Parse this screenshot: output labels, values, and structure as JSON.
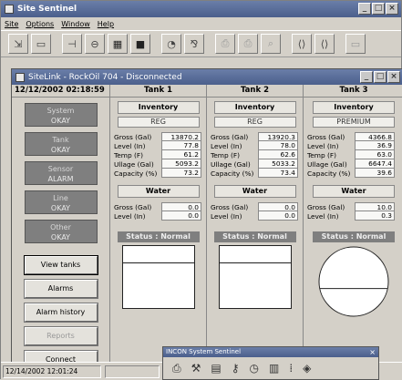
{
  "app": {
    "title": "Site Sentinel",
    "menu": [
      "Site",
      "Options",
      "Window",
      "Help"
    ]
  },
  "toolbar": {
    "icons": [
      "open-icon",
      "save-icon",
      "tank-probe-icon",
      "gauge-icon",
      "monitor-icon",
      "display-icon",
      "alarm-bell-icon",
      "sensor-icon",
      "print-icon",
      "print-preview-icon",
      "report-icon",
      "prev-icon",
      "next-icon",
      "window-icon"
    ]
  },
  "child": {
    "title": "SiteLink - RockOil 704 - Disconnected",
    "datetime": "12/12/2002 02:18:59",
    "status_boxes": [
      {
        "label": "System",
        "state": "OKAY"
      },
      {
        "label": "Tank",
        "state": "OKAY"
      },
      {
        "label": "Sensor",
        "state": "ALARM"
      },
      {
        "label": "Line",
        "state": "OKAY"
      },
      {
        "label": "Other",
        "state": "OKAY"
      }
    ],
    "buttons": {
      "view_tanks": "View tanks",
      "alarms": "Alarms",
      "alarm_history": "Alarm history",
      "reports": "Reports",
      "connect": "Connect"
    }
  },
  "labels": {
    "inventory": "Inventory",
    "water": "Water",
    "gross": "Gross (Gal)",
    "level": "Level (In)",
    "temp": "Temp (F)",
    "ullage": "Ullage (Gal)",
    "capacity": "Capacity (%)"
  },
  "tanks": [
    {
      "name": "Tank 1",
      "product": "REG",
      "gross": "13870.2",
      "level": "77.8",
      "temp": "61.2",
      "ullage": "5093.2",
      "capacity": "73.2",
      "water_gross": "0.0",
      "water_level": "0.0",
      "status": "Status : Normal",
      "fill_fraction": 0.73
    },
    {
      "name": "Tank 2",
      "product": "REG",
      "gross": "13920.3",
      "level": "78.0",
      "temp": "62.6",
      "ullage": "5033.2",
      "capacity": "73.4",
      "water_gross": "0.0",
      "water_level": "0.0",
      "status": "Status : Normal",
      "fill_fraction": 0.73
    },
    {
      "name": "Tank 3",
      "product": "PREMIUM",
      "gross": "4366.8",
      "level": "36.9",
      "temp": "63.0",
      "ullage": "6647.4",
      "capacity": "39.6",
      "water_gross": "10.0",
      "water_level": "0.3",
      "status": "Status : Normal",
      "fill_fraction": 0.4
    }
  ],
  "statusbar": {
    "datetime": "12/14/2002 12:01:24"
  },
  "palette": {
    "title": "INCON System Sentinel",
    "close": "×",
    "icons": [
      "printer-icon",
      "tools-icon",
      "notepad-icon",
      "key-icon",
      "clock-icon",
      "chart-icon",
      "grid-icon",
      "disk-icon"
    ]
  }
}
